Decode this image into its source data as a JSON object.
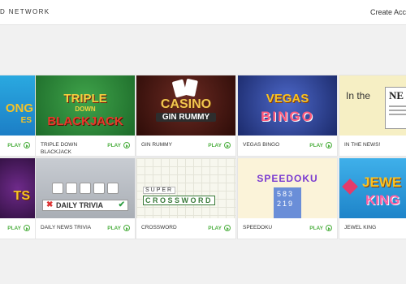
{
  "header": {
    "brand": "D NETWORK",
    "create_account": "Create Accou"
  },
  "play_label": "PLAY",
  "games": [
    {
      "title": "",
      "art": [
        "ONG",
        "ES"
      ]
    },
    {
      "title": "TRIPLE DOWN BLACKJACK",
      "art": [
        "TRIPLE",
        "DOWN",
        "BLACKJACK"
      ]
    },
    {
      "title": "GIN RUMMY",
      "art": [
        "CASINO",
        "GIN RUMMY"
      ]
    },
    {
      "title": "VEGAS BINGO",
      "art": [
        "VEGAS",
        "BINGO"
      ]
    },
    {
      "title": "IN THE NEWS!",
      "art": [
        "In the",
        "NE"
      ]
    },
    {
      "title": "",
      "art": [
        "TS"
      ]
    },
    {
      "title": "DAILY NEWS TRIVIA",
      "art": [
        "DAILY TRIVIA"
      ]
    },
    {
      "title": "CROSSWORD",
      "art": [
        "SUPER",
        "CROSSWORD"
      ]
    },
    {
      "title": "SPEEDOKU",
      "art": [
        "SPEEDOKU",
        "583",
        "219"
      ]
    },
    {
      "title": "JEWEL KING",
      "art": [
        "JEWE",
        "KING"
      ]
    }
  ],
  "colors": {
    "play_green": "#4caf3f",
    "background": "#f1f1f1"
  }
}
